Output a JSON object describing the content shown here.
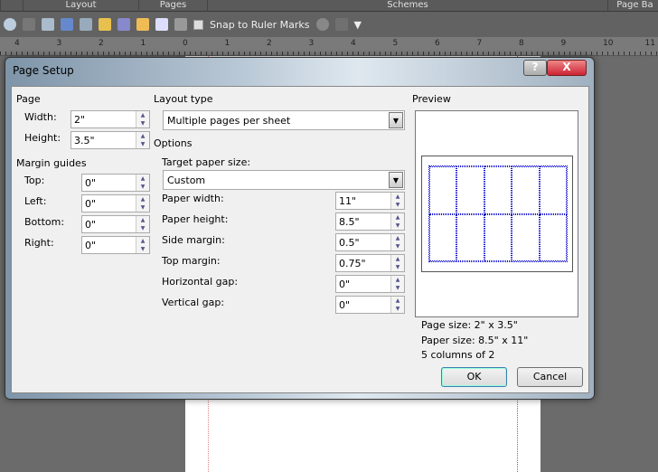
{
  "ribbon_tabs": [
    "Layout",
    "Pages",
    "Schemes",
    "Page Ba"
  ],
  "toolbar": {
    "snap_label": "Snap to Ruler Marks",
    "icons": [
      "zoom-icon",
      "paragraph-icon",
      "print-icon",
      "spelling-icon",
      "print-merge-icon",
      "folder-icon",
      "edit-icon",
      "insert-icon",
      "textbox-icon",
      "align-icon",
      "checkbox-icon",
      "globe-icon",
      "brush-icon",
      "overflow-icon"
    ]
  },
  "ruler": {
    "ticks": [
      "4",
      "3",
      "2",
      "1",
      "0",
      "1",
      "2",
      "3",
      "4",
      "5",
      "6",
      "7",
      "8",
      "9",
      "10",
      "11"
    ]
  },
  "dialog": {
    "title": "Page Setup",
    "help": "?",
    "close": "X",
    "page": {
      "heading": "Page",
      "width_label": "Width:",
      "width": "2\"",
      "height_label": "Height:",
      "height": "3.5\""
    },
    "margins": {
      "heading": "Margin guides",
      "top_label": "Top:",
      "top": "0\"",
      "left_label": "Left:",
      "left": "0\"",
      "bottom_label": "Bottom:",
      "bottom": "0\"",
      "right_label": "Right:",
      "right": "0\""
    },
    "layout": {
      "heading": "Layout type",
      "value": "Multiple pages per sheet"
    },
    "options": {
      "heading": "Options",
      "target_label": "Target paper size:",
      "target": "Custom",
      "paper_width_label": "Paper width:",
      "paper_width": "11\"",
      "paper_height_label": "Paper height:",
      "paper_height": "8.5\"",
      "side_margin_label": "Side margin:",
      "side_margin": "0.5\"",
      "top_margin_label": "Top margin:",
      "top_margin": "0.75\"",
      "hgap_label": "Horizontal gap:",
      "hgap": "0\"",
      "vgap_label": "Vertical gap:",
      "vgap": "0\""
    },
    "preview": {
      "heading": "Preview",
      "columns": 5,
      "rows": 2,
      "page_size": "Page size: 2\" x 3.5\"",
      "paper_size": "Paper size: 8.5\" x 11\"",
      "summary": "5 columns of 2"
    },
    "ok": "OK",
    "cancel": "Cancel"
  }
}
